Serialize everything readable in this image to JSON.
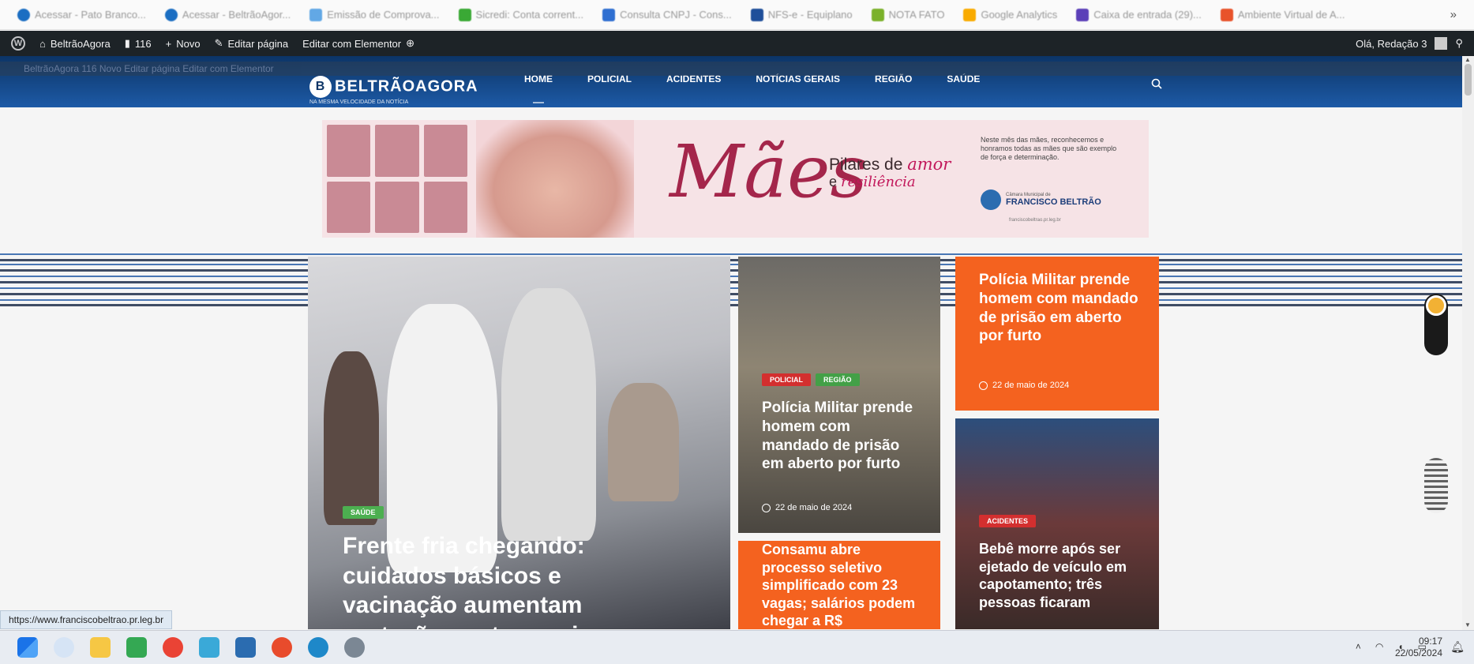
{
  "bookmarks": {
    "items": [
      {
        "label": "Acessar - Pato Branco...",
        "color": "#1b6ec2"
      },
      {
        "label": "Acessar - BeltrãoAgor...",
        "color": "#1b6ec2"
      },
      {
        "label": "Emissão de Comprova...",
        "color": "#62a8e5"
      },
      {
        "label": "Sicredi: Conta corrent...",
        "color": "#3aa935"
      },
      {
        "label": "Consulta CNPJ - Cons...",
        "color": "#2f6fd1"
      },
      {
        "label": "NFS-e - Equiplano",
        "color": "#1f4f9a"
      },
      {
        "label": "NOTA FATO",
        "color": "#7bb12a"
      },
      {
        "label": "Google Analytics",
        "color": "#f9ab00"
      },
      {
        "label": "Caixa de entrada (29)...",
        "color": "#5b3fb8"
      },
      {
        "label": "Ambiente Virtual de A...",
        "color": "#e8532b"
      }
    ],
    "more": "»"
  },
  "admin_bar": {
    "site": "BeltrãoAgora",
    "comments": "116",
    "new": "Novo",
    "edit": "Editar página",
    "elementor": "Editar com Elementor",
    "greeting": "Olá, Redação 3"
  },
  "ghost_bar": "BeltrãoAgora   116   Novo   Editar página   Editar com Elementor",
  "header": {
    "logo": "BELTRÃOAGORA",
    "tagline": "NA MESMA VELOCIDADE DA NOTÍCIA",
    "nav": [
      "HOME",
      "POLICIAL",
      "ACIDENTES",
      "NOTÍCIAS GERAIS",
      "REGIÃO",
      "SAÚDE"
    ]
  },
  "banner": {
    "title": "Mães",
    "pilares": "Pilares de",
    "amor": "amor",
    "e": "e",
    "resiliencia": "resiliência",
    "text": "Neste mês das mães, reconhecemos e honramos todas as mães que são exemplo de força e determinação.",
    "org_small": "Câmara Municipal de",
    "org": "FRANCISCO BELTRÃO",
    "url": "franciscobeltrao.pr.leg.br",
    "colors": {
      "background": "#f6e3e6",
      "accent": "#a4264b"
    }
  },
  "cards": {
    "main": {
      "tag": "SAÚDE",
      "title": "Frente fria chegando: cuidados básicos e vacinação aumentam proteção contra a gripe"
    },
    "mid": {
      "tags": [
        "POLICIAL",
        "REGIÃO"
      ],
      "title": "Polícia Militar prende homem com mandado de prisão em aberto por furto",
      "date": "22 de maio de 2024"
    },
    "mid2": {
      "title": "Consamu abre processo seletivo simplificado com 23 vagas; salários podem chegar a R$"
    },
    "right": {
      "title": "Polícia Militar prende homem com mandado de prisão em aberto por furto",
      "date": "22 de maio de 2024"
    },
    "right2": {
      "tag": "ACIDENTES",
      "title": "Bebê morre após ser ejetado de veículo em capotamento; três pessoas ficaram"
    },
    "colors": {
      "orange": "#f4621f",
      "saude_tag": "#4caf50",
      "policial_tag": "#d32f2f",
      "regiao_tag": "#43a047"
    }
  },
  "status_url": "https://www.franciscobeltrao.pr.leg.br",
  "taskbar": {
    "time": "09:17",
    "date": "22/05/2024"
  }
}
